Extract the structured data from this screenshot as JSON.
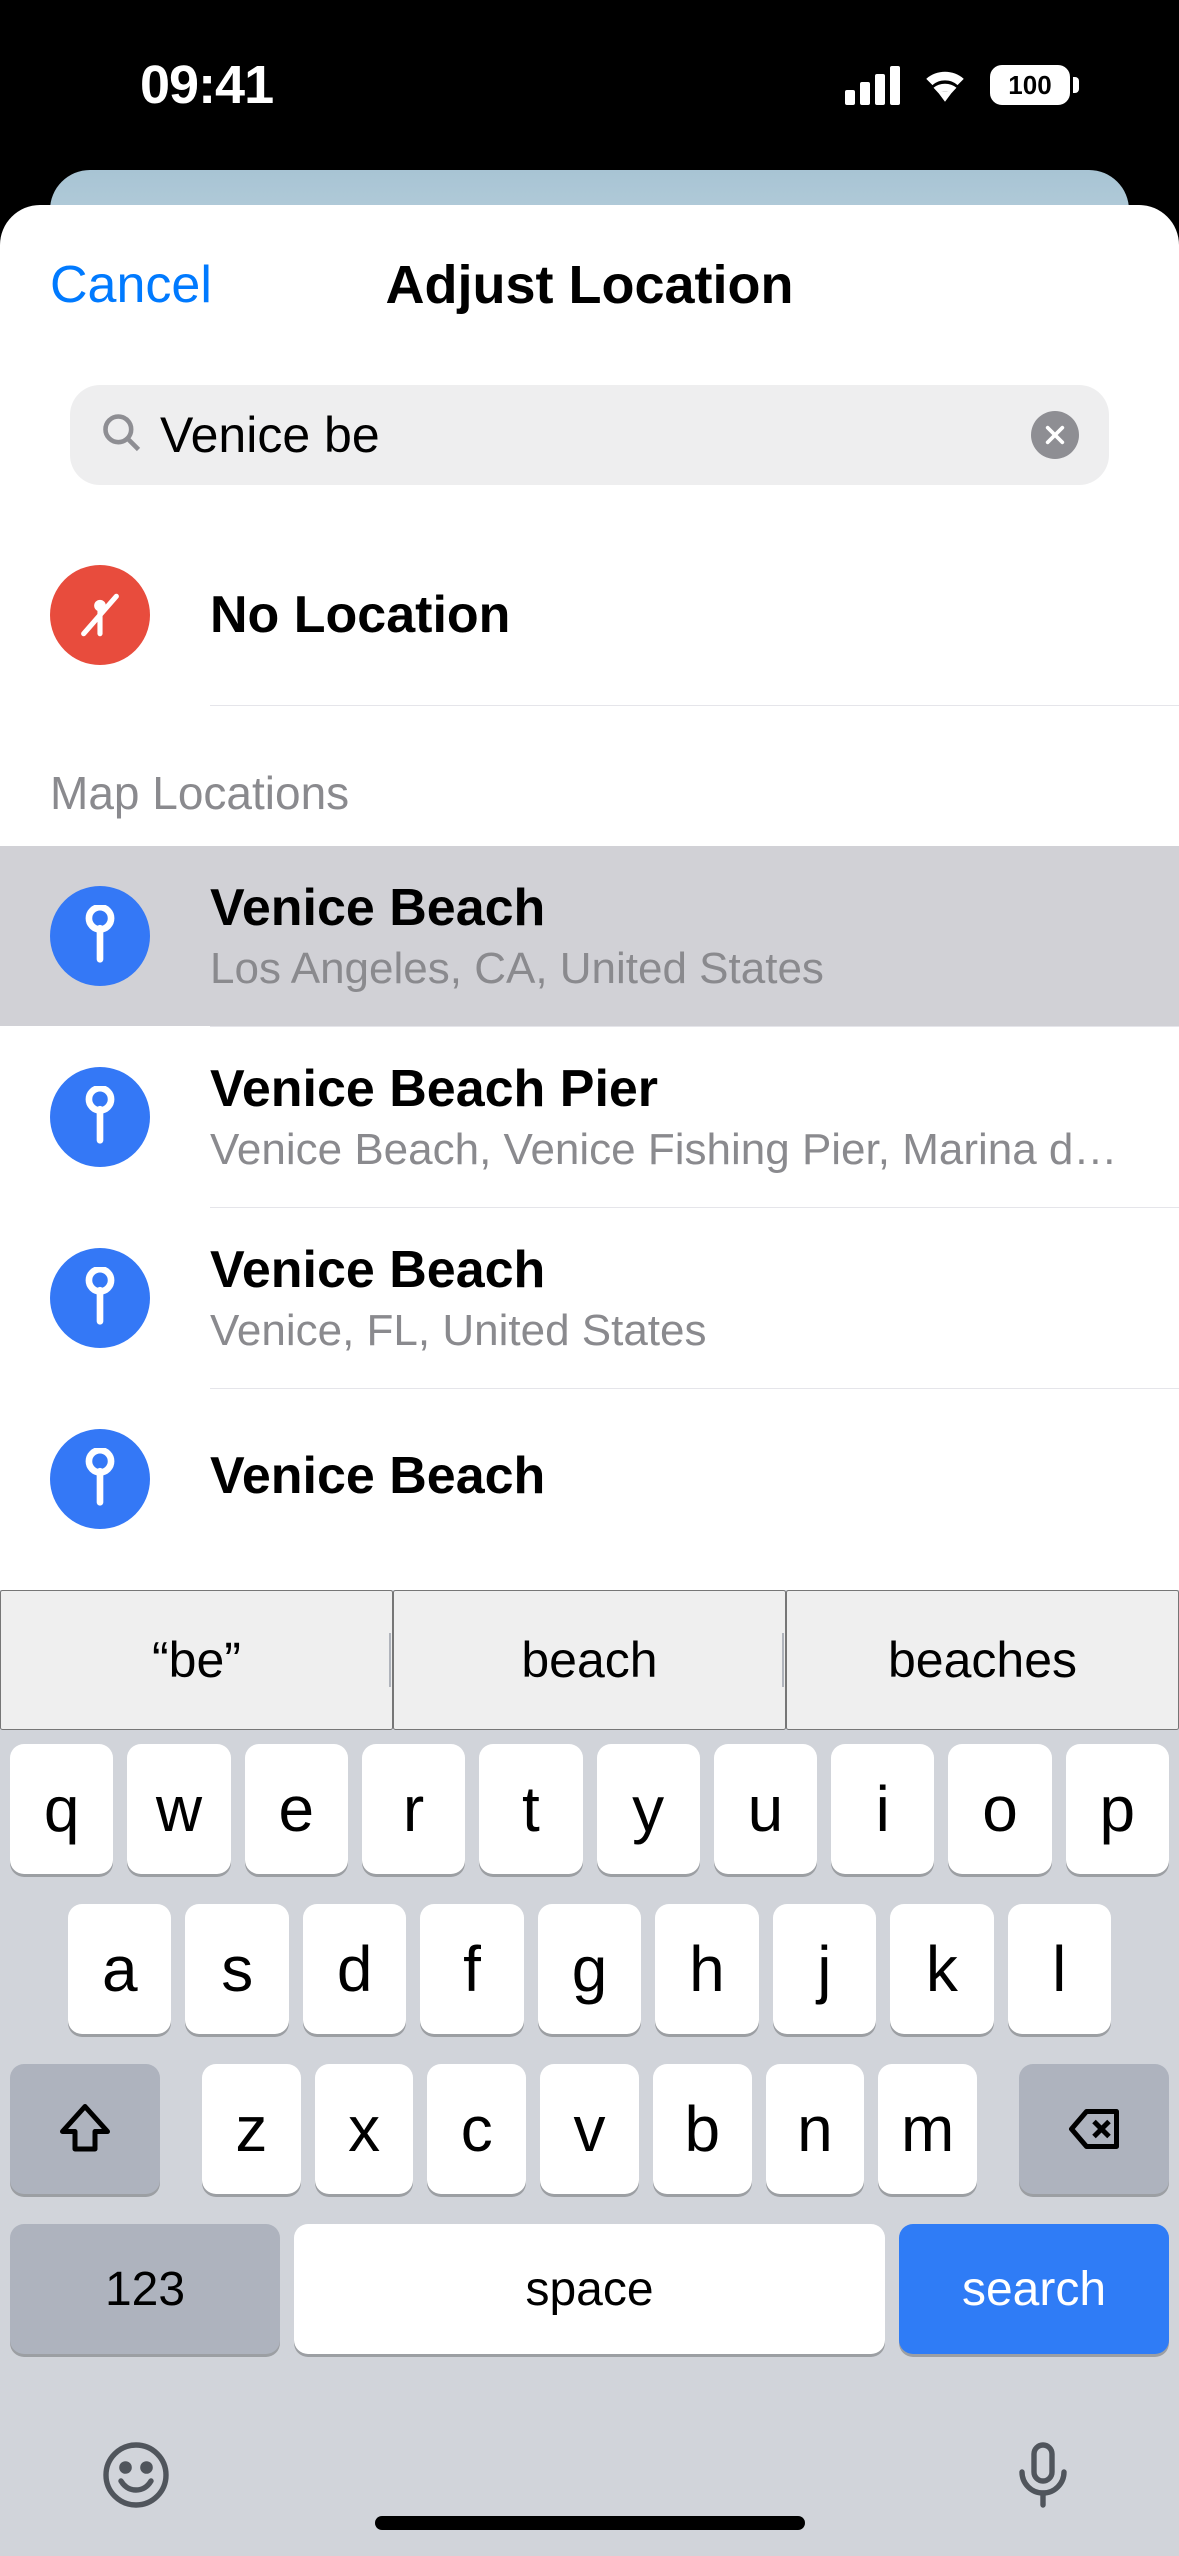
{
  "status": {
    "time": "09:41",
    "battery": "100"
  },
  "header": {
    "cancel": "Cancel",
    "title": "Adjust Location"
  },
  "search": {
    "query": "Venice be"
  },
  "no_location": {
    "label": "No Location"
  },
  "section_header": "Map Locations",
  "results": [
    {
      "title": "Venice Beach",
      "subtitle": "Los Angeles, CA, United States",
      "selected": true
    },
    {
      "title": "Venice Beach Pier",
      "subtitle": "Venice Beach, Venice Fishing Pier, Marina del Rey, CA  9…",
      "selected": false
    },
    {
      "title": "Venice Beach",
      "subtitle": "Venice, FL, United States",
      "selected": false
    },
    {
      "title": "Venice Beach",
      "subtitle": "",
      "selected": false
    }
  ],
  "keyboard": {
    "suggestions": [
      "“be”",
      "beach",
      "beaches"
    ],
    "row1": [
      "q",
      "w",
      "e",
      "r",
      "t",
      "y",
      "u",
      "i",
      "o",
      "p"
    ],
    "row2": [
      "a",
      "s",
      "d",
      "f",
      "g",
      "h",
      "j",
      "k",
      "l"
    ],
    "row3": [
      "z",
      "x",
      "c",
      "v",
      "b",
      "n",
      "m"
    ],
    "numbers": "123",
    "space": "space",
    "action": "search"
  }
}
